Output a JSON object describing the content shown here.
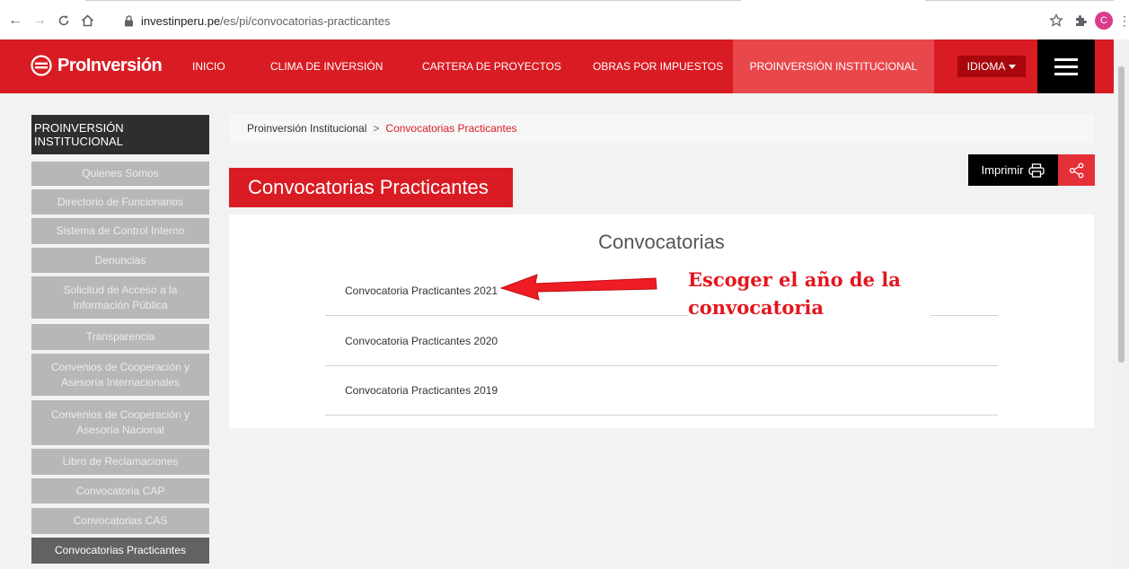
{
  "browser": {
    "url_domain": "investinperu.pe",
    "url_path": "/es/pi/convocatorias-practicantes",
    "avatar_letter": "C"
  },
  "header": {
    "logo_text": "ProInversión",
    "menu": [
      {
        "label": "INICIO"
      },
      {
        "label": "CLIMA DE INVERSIÓN"
      },
      {
        "label": "CARTERA DE PROYECTOS"
      },
      {
        "label": "OBRAS POR IMPUESTOS"
      },
      {
        "label": "PROINVERSIÓN INSTITUCIONAL",
        "active": true
      }
    ],
    "language_label": "IDIOMA",
    "colors": {
      "brand": "#d91c23",
      "active": "#e8474c",
      "language": "#a8070d"
    }
  },
  "sidebar": {
    "title": "PROINVERSIÓN INSTITUCIONAL",
    "items": [
      {
        "label": "Quienes Somos"
      },
      {
        "label": "Directorio de Funcionarios"
      },
      {
        "label": "Sistema de Control Interno"
      },
      {
        "label": "Denuncias"
      },
      {
        "label": "Solicitud de Acceso a la Información Pública"
      },
      {
        "label": "Transparencia"
      },
      {
        "label": "Convenios de Cooperación y Asesoría Internacionales"
      },
      {
        "label": "Convenios de Cooperación y Asesoría Nacional"
      },
      {
        "label": "Libro de Reclamaciones"
      },
      {
        "label": "Convocatoria CAP"
      },
      {
        "label": "Convocatorias CAS"
      },
      {
        "label": "Convocatorias Practicantes",
        "active": true
      }
    ]
  },
  "breadcrumb": {
    "parent": "Proinversión Institucional",
    "separator": ">",
    "current": "Convocatorias Practicantes"
  },
  "main": {
    "title": "Convocatorias Practicantes",
    "print_label": "Imprimir",
    "heading": "Convocatorias",
    "convocatorias": [
      {
        "label": "Convocatoria Practicantes 2021"
      },
      {
        "label": "Convocatoria Practicantes 2020"
      },
      {
        "label": "Convocatoria Practicantes 2019"
      }
    ]
  },
  "annotation": {
    "line1": "Escoger el año de la",
    "line2": "convocatoria"
  }
}
